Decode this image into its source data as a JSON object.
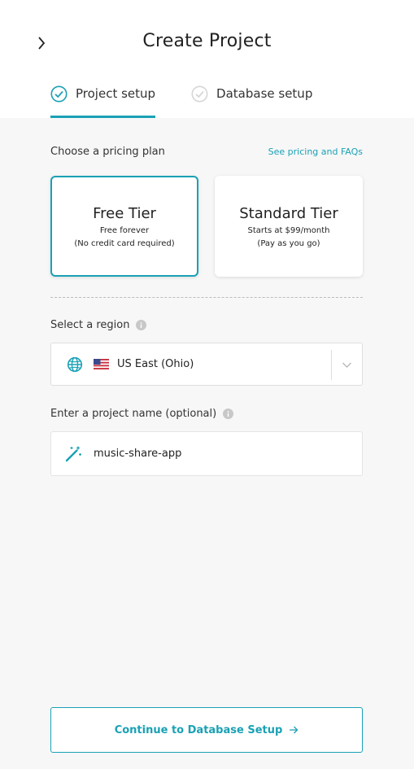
{
  "header": {
    "title": "Create Project",
    "back_icon": "chevron-right-icon"
  },
  "steps": [
    {
      "label": "Project setup",
      "state": "active",
      "icon": "check-circle-icon"
    },
    {
      "label": "Database setup",
      "state": "inactive",
      "icon": "check-circle-icon"
    }
  ],
  "pricing": {
    "label": "Choose a pricing plan",
    "link": "See pricing and FAQs",
    "plans": [
      {
        "name": "Free Tier",
        "line1": "Free forever",
        "line2": "(No credit card required)",
        "selected": true
      },
      {
        "name": "Standard Tier",
        "line1": "Starts at $99/month",
        "line2": "(Pay as you go)",
        "selected": false
      }
    ]
  },
  "region": {
    "label": "Select a region",
    "selected": "US East (Ohio)",
    "flag": "us-flag-icon"
  },
  "project_name": {
    "label": "Enter a project name (optional)",
    "value": "music-share-app"
  },
  "footer": {
    "continue_label": "Continue to Database Setup"
  },
  "colors": {
    "accent": "#1aa1b5",
    "background": "#f7f7f7"
  }
}
